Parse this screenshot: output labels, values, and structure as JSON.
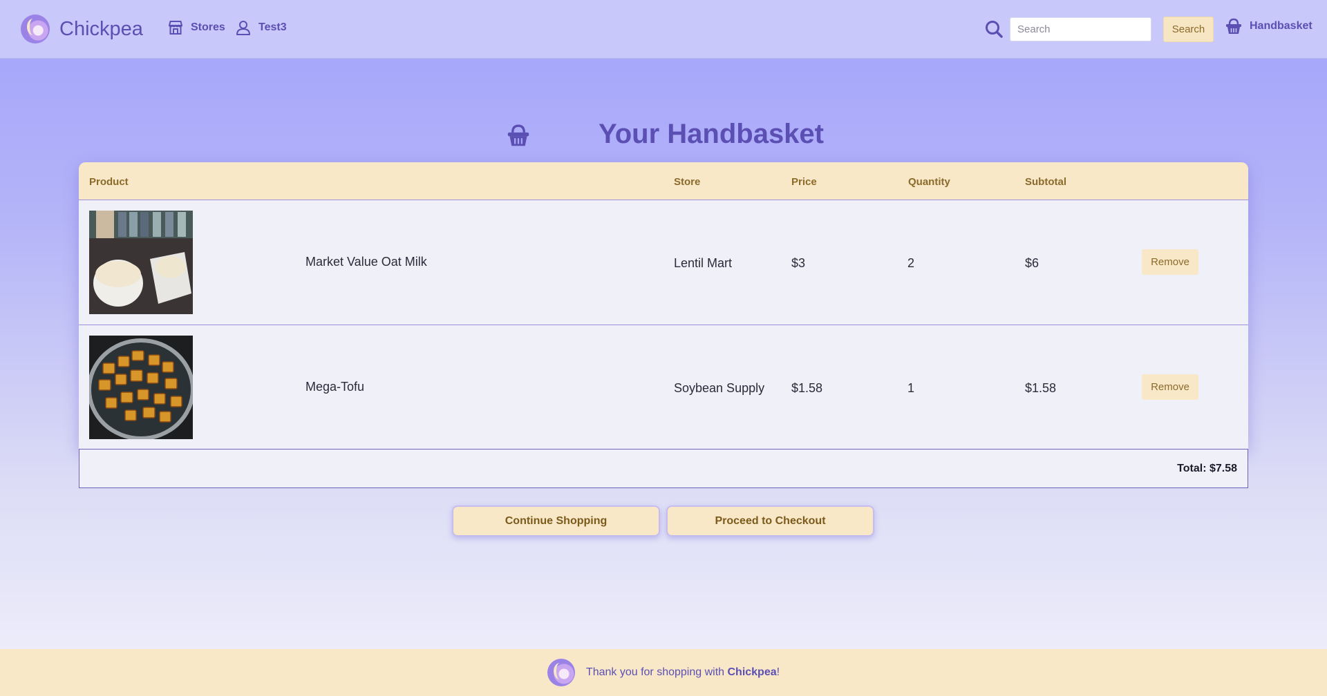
{
  "brand": {
    "name": "Chickpea"
  },
  "nav": {
    "stores_label": "Stores",
    "user_label": "Test3",
    "search_placeholder": "Search",
    "search_button": "Search",
    "basket_label": "Handbasket"
  },
  "page": {
    "title": "Your Handbasket"
  },
  "table": {
    "headers": {
      "product": "Product",
      "store": "Store",
      "price": "Price",
      "quantity": "Quantity",
      "subtotal": "Subtotal"
    },
    "rows": [
      {
        "name": "Market Value Oat Milk",
        "store": "Lentil Mart",
        "price": "$3",
        "quantity": "2",
        "subtotal": "$6",
        "remove": "Remove"
      },
      {
        "name": "Mega-Tofu",
        "store": "Soybean Supply",
        "price": "$1.58",
        "quantity": "1",
        "subtotal": "$1.58",
        "remove": "Remove"
      }
    ],
    "total": "Total: $7.58"
  },
  "actions": {
    "continue": "Continue Shopping",
    "checkout": "Proceed to Checkout"
  },
  "footer": {
    "text_before": "Thank you for shopping with ",
    "brand": "Chickpea",
    "text_after": "!"
  },
  "colors": {
    "accent": "#5b4fb3",
    "navbar": "#c8c8fa",
    "button": "#f8e8c8",
    "button_text": "#8b6a2a"
  },
  "icons": {
    "stores": "storefront-icon",
    "user": "user-icon",
    "search": "search-icon",
    "basket": "basket-icon"
  }
}
